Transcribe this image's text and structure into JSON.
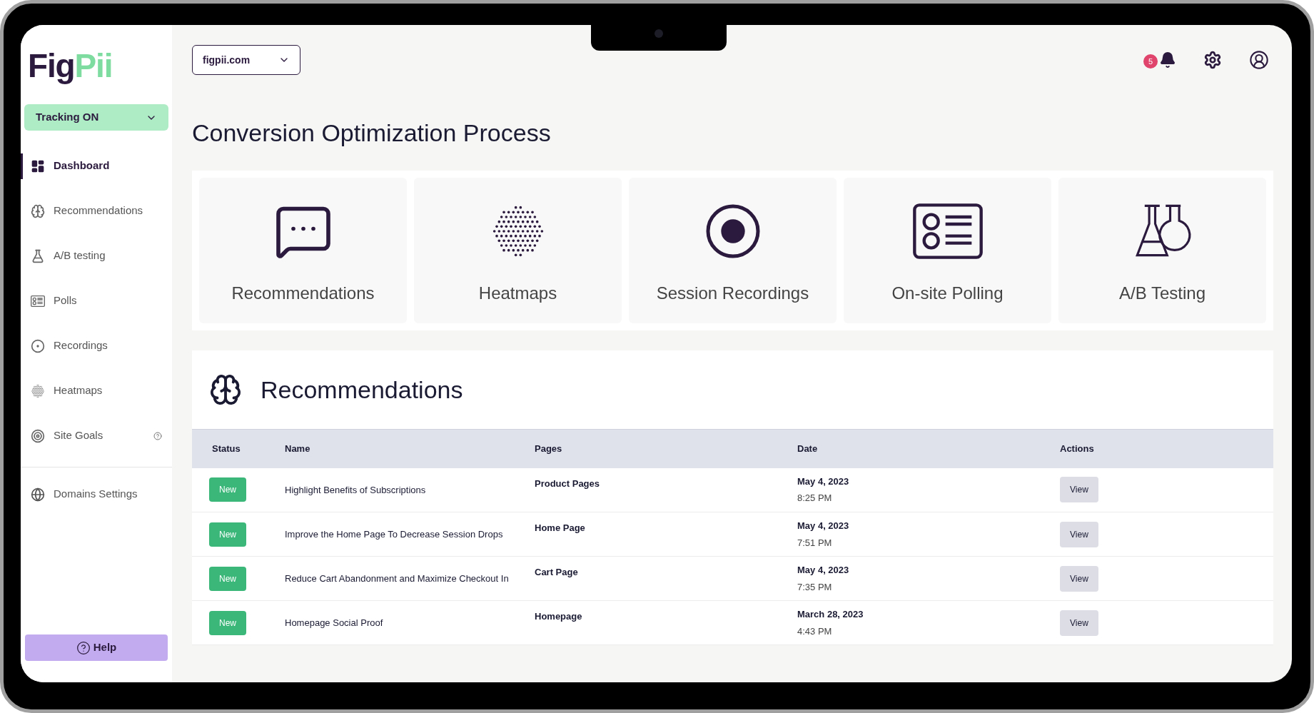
{
  "sidebar": {
    "logo": {
      "part_1": "Fig",
      "part_2": "Pii"
    },
    "tracking": {
      "label": "Tracking ON",
      "on": true
    },
    "items": [
      {
        "label": "Dashboard",
        "selected": true
      },
      {
        "label": "Recommendations",
        "selected": false
      },
      {
        "label": "A/B testing",
        "selected": false
      },
      {
        "label": "Polls",
        "selected": false
      },
      {
        "label": "Recordings",
        "selected": false
      },
      {
        "label": "Heatmaps",
        "selected": false
      },
      {
        "label": "Site Goals",
        "selected": false,
        "info": true
      }
    ],
    "settings_item": {
      "label": "Domains Settings",
      "selected": false
    },
    "help": "Help"
  },
  "topbar": {
    "domain": "figpii.com",
    "notifications": "5"
  },
  "title": "Conversion Optimization Process",
  "process_cards": [
    {
      "label": "Recommendations"
    },
    {
      "label": "Heatmaps"
    },
    {
      "label": "Session Recordings"
    },
    {
      "label": "On-site Polling"
    },
    {
      "label": "A/B Testing"
    }
  ],
  "recommendations": {
    "title": "Recommendations",
    "columns": [
      "Status",
      "Name",
      "Pages",
      "Date",
      "Actions"
    ],
    "rows": [
      {
        "status": "New",
        "name": "Highlight Benefits of Subscriptions",
        "pages": "Product Pages",
        "date": "May 4, 2023",
        "time": "8:25 PM",
        "action": "View"
      },
      {
        "status": "New",
        "name": "Improve the Home Page To Decrease Session Drops",
        "pages": "Home Page",
        "date": "May 4, 2023",
        "time": "7:51 PM",
        "action": "View"
      },
      {
        "status": "New",
        "name": "Reduce Cart Abandonment and Maximize Checkout In",
        "pages": "Cart Page",
        "date": "May 4, 2023",
        "time": "7:35 PM",
        "action": "View"
      },
      {
        "status": "New",
        "name": "Homepage Social Proof",
        "pages": "Homepage",
        "date": "March 28, 2023",
        "time": "4:43 PM",
        "action": "View"
      }
    ]
  }
}
